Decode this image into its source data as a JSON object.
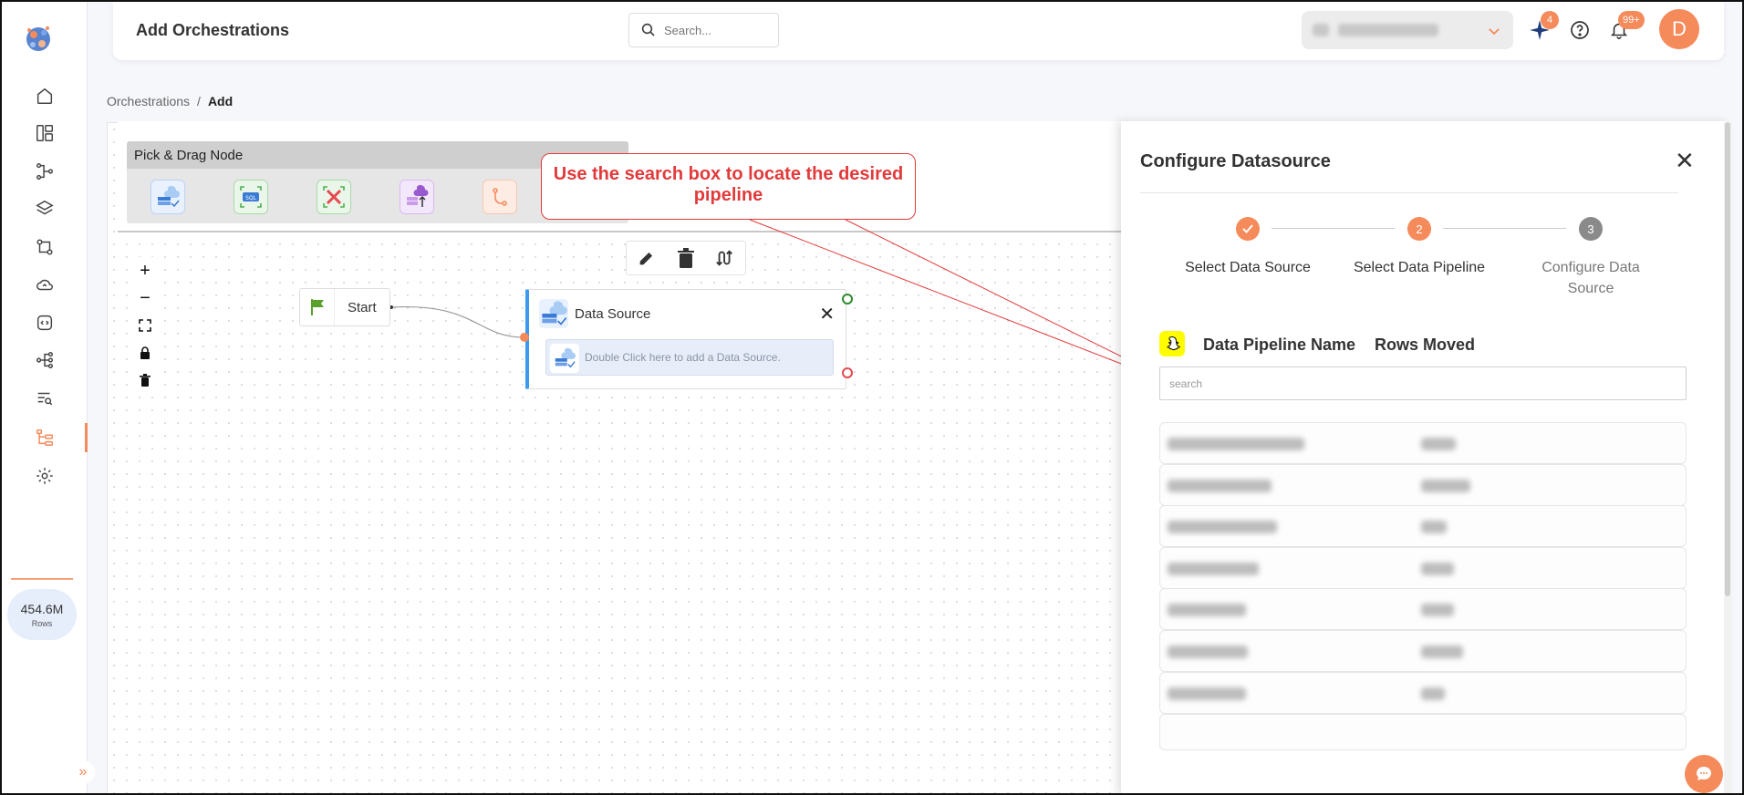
{
  "app": {
    "page_title": "Add Orchestrations",
    "search_placeholder": "Search...",
    "notification_badge": "99+",
    "ai_badge": "4",
    "avatar_initial": "D",
    "accent_color": "#f58a5b"
  },
  "sidebar": {
    "items": [
      {
        "name": "home-icon"
      },
      {
        "name": "dashboard-icon"
      },
      {
        "name": "pipeline-icon"
      },
      {
        "name": "layers-icon"
      },
      {
        "name": "workflow-icon"
      },
      {
        "name": "cloud-sync-icon"
      },
      {
        "name": "code-icon"
      },
      {
        "name": "lineage-icon"
      },
      {
        "name": "query-list-icon"
      },
      {
        "name": "orchestration-icon",
        "active": true
      },
      {
        "name": "settings-icon"
      }
    ],
    "rows_value": "454.6M",
    "rows_label": "Rows"
  },
  "breadcrumb": {
    "parent": "Orchestrations",
    "separator": "/",
    "current": "Add"
  },
  "palette": {
    "title": "Pick & Drag Node",
    "nodes": [
      "datasource-node-icon",
      "sql-node-icon",
      "transform-node-icon",
      "upload-node-icon",
      "branch-node-icon"
    ]
  },
  "flow": {
    "start_label": "Start",
    "ds_title": "Data Source",
    "ds_hint": "Double Click here to add a Data Source."
  },
  "callout": {
    "text": "Use the search box to locate the desired pipeline"
  },
  "panel": {
    "title": "Configure Datasource",
    "steps": [
      {
        "number": "",
        "label": "Select Data Source",
        "state": "done"
      },
      {
        "number": "2",
        "label": "Select Data Pipeline",
        "state": "active"
      },
      {
        "number": "3",
        "label": "Configure Data Source",
        "state": "pending"
      }
    ],
    "col_name": "Data Pipeline Name",
    "col_rows": "Rows Moved",
    "search_placeholder": "search",
    "row_count_visible": 7
  }
}
